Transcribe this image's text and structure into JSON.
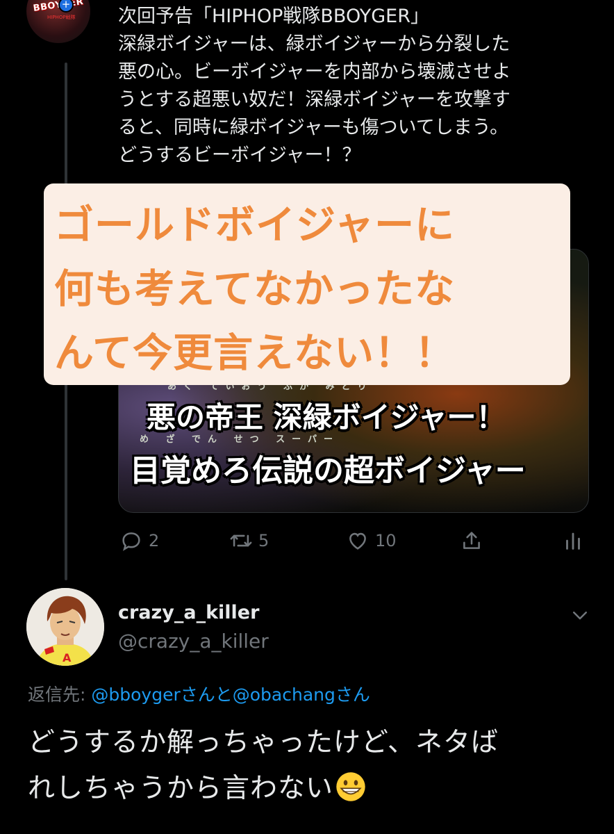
{
  "colors": {
    "background": "#000000",
    "text": "#e7e9ea",
    "secondary": "#71767b",
    "link": "#1d9bf0",
    "overlay_bg": "#fbeee5",
    "overlay_text": "#ef8a3c"
  },
  "first_tweet": {
    "avatar_logo": "BBOYGER",
    "avatar_small": "HIPHOP戦隊",
    "lines": [
      "次回予告「HIPHOP戦隊BBOYGER」",
      "深緑ボイジャーは、緑ボイジャーから分裂した",
      "悪の心。ビーボイジャーを内部から壊滅させよ",
      "うとする超悪い奴だ！深緑ボイジャーを攻撃す",
      "ると、同時に緑ボイジャーも傷ついてしまう。",
      "どうするビーボイジャー！？"
    ],
    "media": {
      "ruby1": "あく  ていおう  ふか みどり",
      "caption1": "悪の帝王 深緑ボイジャー！",
      "ruby2": "め   ざ         でん  せつ     スーパー",
      "caption2": "目覚めろ伝説の超ボイジャー"
    },
    "actions": {
      "reply_icon": "reply-icon",
      "reply_count": "2",
      "retweet_icon": "retweet-icon",
      "retweet_count": "5",
      "like_icon": "heart-icon",
      "like_count": "10",
      "share_icon": "share-icon",
      "analytics_icon": "analytics-icon"
    }
  },
  "overlay": {
    "lines": [
      "ゴールドボイジャーに",
      "何も考えてなかったな",
      "んて今更言えない！！"
    ]
  },
  "reply": {
    "display_name": "crazy_a_killer",
    "handle": "@crazy_a_killer",
    "menu_icon": "chevron-down-icon",
    "reply_to_prefix": "返信先: ",
    "reply_to_user1": "@bboygerさん",
    "reply_to_joiner": "と",
    "reply_to_user2": "@obachangさん",
    "text_line1": "どうするか解っちゃったけど、ネタば",
    "text_line2": "れしちゃうから言わない",
    "emoji": "grinning-face-emoji"
  }
}
